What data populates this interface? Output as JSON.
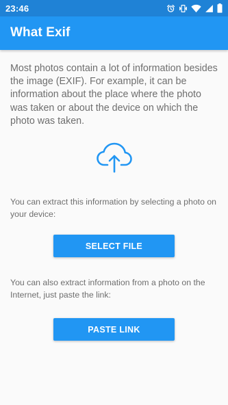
{
  "status_bar": {
    "time": "23:46",
    "icons": [
      "alarm-icon",
      "vibrate-icon",
      "wifi-icon",
      "signal-icon",
      "battery-icon"
    ]
  },
  "app_bar": {
    "title": "What Exif"
  },
  "main": {
    "intro": "Most photos contain a lot of information besides the image (EXIF). For example, it can be information about the place where the photo was taken or about the device on which the photo was taken.",
    "upload_icon": "cloud-upload-icon",
    "select_prompt": "You can extract this information by selecting a photo on your device:",
    "select_button": "SELECT FILE",
    "paste_prompt": "You can also extract information from a photo on the Internet, just paste the link:",
    "paste_button": "PASTE LINK"
  },
  "colors": {
    "primary": "#2196f3",
    "primary_dark": "#1f82d6",
    "text_secondary": "#6e6e6e",
    "background": "#fafafa"
  }
}
